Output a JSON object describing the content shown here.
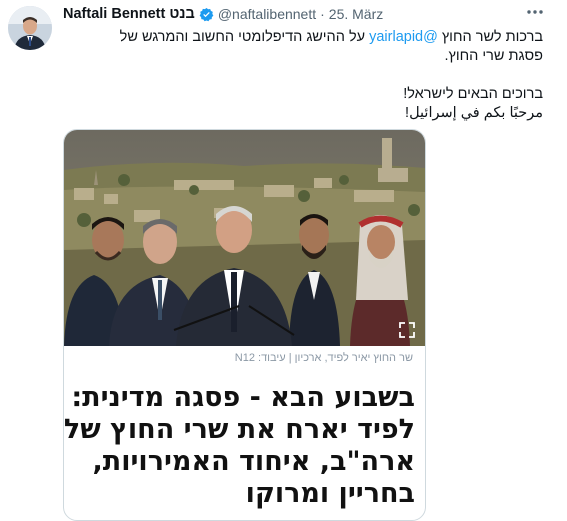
{
  "author": {
    "name": "Naftali Bennett",
    "name_hebrew": "בנט",
    "handle": "@naftalibennett",
    "separator": "·",
    "date": "25. März"
  },
  "more_icon": "more-options-icon",
  "tweet": {
    "line1_prefix": "ברכות לשר החוץ ",
    "mention": "@yairlapid",
    "line1_suffix": " על ההישג הדיפלומטי החשוב והמרגש של",
    "line2": "פסגת שרי החוץ.",
    "line3": "ברוכים הבאים לישראל!",
    "line4": "مرحبًا بكم في إسرائيل!"
  },
  "card": {
    "credit": "שר החוץ יאיר לפיד, ארכיון | עיבוד: N12",
    "headline": [
      "בשבוע הבא - פסגה מדינית:",
      "לפיד יארח את שרי החוץ של",
      "ארה\"ב, איחוד האמירויות,",
      "בחריין ומרוקו"
    ]
  },
  "colors": {
    "accent": "#1d9bf0",
    "text": "#0f1419",
    "muted": "#536471",
    "border": "#cfd9de"
  }
}
